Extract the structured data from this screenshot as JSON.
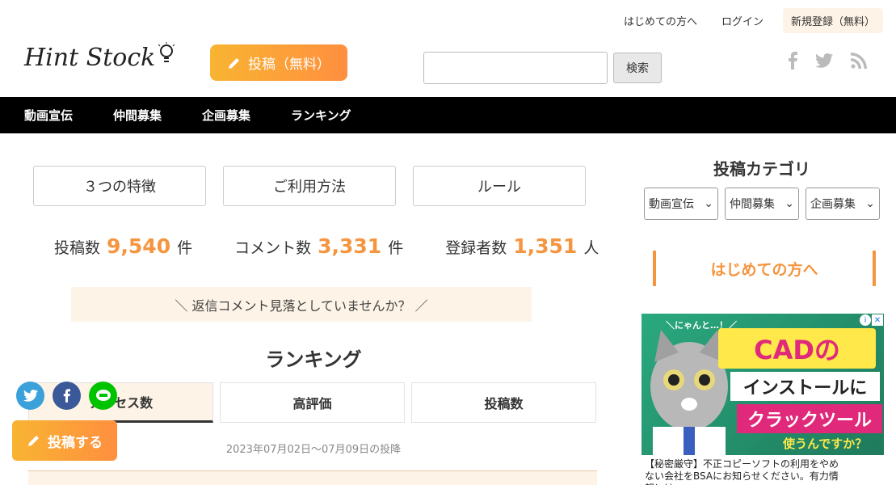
{
  "header": {
    "links": [
      "はじめての方へ",
      "ログイン",
      "新規登録（無料）"
    ],
    "logo_text": "Hint Stock",
    "post_button": "投稿（無料）",
    "search_placeholder": "",
    "search_button": "検索"
  },
  "nav": [
    "動画宣伝",
    "仲間募集",
    "企画募集",
    "ランキング"
  ],
  "features": [
    "３つの特徴",
    "ご利用方法",
    "ルール"
  ],
  "stats": [
    {
      "label": "投稿数",
      "value": "9,540",
      "unit": "件"
    },
    {
      "label": "コメント数",
      "value": "3,331",
      "unit": "件"
    },
    {
      "label": "登録者数",
      "value": "1,351",
      "unit": "人"
    }
  ],
  "reply_banner": "＼ 返信コメント見落としていませんか？ ／",
  "ranking": {
    "title": "ランキング",
    "tabs": [
      "アクセス数",
      "高評価",
      "投稿数"
    ],
    "date_range": "2023年07月02日〜07月09日の投降"
  },
  "float_post": "投稿する",
  "sidebar": {
    "category_title": "投稿カテゴリ",
    "selects": [
      "動画宣伝",
      "仲間募集",
      "企画募集"
    ],
    "hajimete": "はじめての方へ"
  },
  "ad": {
    "nyan": "＼にゃんと…！／",
    "line1": "CADの",
    "line2": "インストールに",
    "line3": "クラックツール",
    "line4": "使うんですか？",
    "caption": "【秘密厳守】不正コピーソフトの利用をやめない会社をBSAにお知らせください。有力情報には"
  },
  "colors": {
    "accent": "#f5953f",
    "nav_bg": "#000000",
    "banner_bg": "#fdf3e6"
  }
}
